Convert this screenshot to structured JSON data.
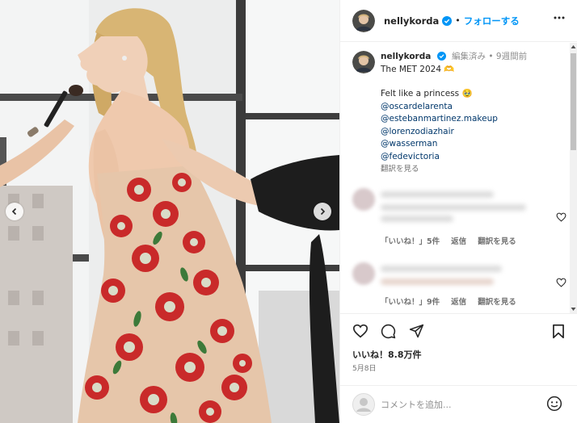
{
  "post": {
    "username": "nellykorda",
    "follow_label": "フォローする",
    "separator": "•",
    "edited_label": "編集済み",
    "time_ago": "9週間前"
  },
  "caption": {
    "title": "The MET 2024 🫶",
    "line2": "Felt like a princess 🥹",
    "mentions": [
      "@oscardelarenta",
      "@estebanmartinez.makeup",
      "@lorenzodiazhair",
      "@wasserman",
      "@fedevictoria"
    ],
    "see_translation": "翻訳を見る"
  },
  "comments": [
    {
      "likes_label": "「いいね！」5件",
      "reply_label": "返信",
      "translate_label": "翻訳を見る"
    },
    {
      "likes_label": "「いいね！」9件",
      "reply_label": "返信",
      "translate_label": "翻訳を見る"
    }
  ],
  "footer": {
    "likes_count": "いいね！8.8万件",
    "date": "5月8日",
    "comment_placeholder": "コメントを追加..."
  },
  "icons": [
    "chevron-left-icon",
    "chevron-right-icon",
    "verified-icon",
    "more-icon",
    "heart-icon",
    "comment-icon",
    "share-icon",
    "bookmark-icon",
    "emoji-icon"
  ],
  "colors": {
    "accent": "#0095f6",
    "mention": "#00376b",
    "verified": "#0095f6"
  }
}
